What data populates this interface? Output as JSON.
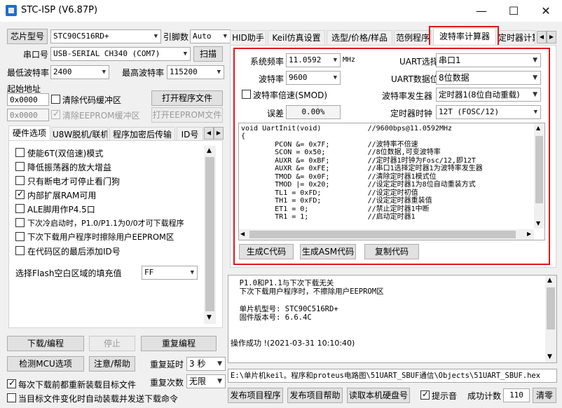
{
  "window": {
    "title": "STC-ISP (V6.87P)",
    "min": "—",
    "max": "☐",
    "close": "✕"
  },
  "left": {
    "chip_label": "芯片型号",
    "chip_value": "STC90C516RD+",
    "pin_label": "引脚数",
    "pin_value": "Auto",
    "port_label": "串口号",
    "port_value": "USB-SERIAL CH340 (COM7)",
    "scan_btn": "扫描",
    "min_baud_label": "最低波特率",
    "min_baud_value": "2400",
    "max_baud_label": "最高波特率",
    "max_baud_value": "115200",
    "start_addr_label": "起始地址",
    "addr1": "0x0000",
    "clear_code": "清除代码缓冲区",
    "open_prog": "打开程序文件",
    "addr2": "0x0000",
    "clear_eeprom": "清除EEPROM缓冲区",
    "open_eeprom": "打开EEPROM文件",
    "tabs": [
      "硬件选项",
      "U8W脱机/联机",
      "程序加密后传输",
      "ID号"
    ],
    "options": [
      {
        "label": "使能6T(双倍速)模式",
        "checked": false
      },
      {
        "label": "降低振荡器的放大增益",
        "checked": false
      },
      {
        "label": "只有断电才可停止看门狗",
        "checked": false
      },
      {
        "label": "内部扩展RAM可用",
        "checked": true
      },
      {
        "label": "ALE脚用作P4.5口",
        "checked": false
      },
      {
        "label": "下次冷启动时，P1.0/P1.1为0/0才可下载程序",
        "checked": false
      },
      {
        "label": "下次下载用户程序时擦除用户EEPROM区",
        "checked": false
      },
      {
        "label": "在代码区的最后添加ID号",
        "checked": false
      }
    ],
    "flash_fill_label": "选择Flash空白区域的填充值",
    "flash_fill_value": "FF",
    "download_btn": "下载/编程",
    "stop_btn": "停止",
    "reprog_btn": "重复编程",
    "detect_btn": "检测MCU选项",
    "help_btn": "注意/帮助",
    "delay_label": "重复延时",
    "delay_value": "3 秒",
    "reload_cb": "每次下载前都重新装载目标文件",
    "count_label": "重复次数",
    "count_value": "无限",
    "autoload_cb": "当目标文件变化时自动装载并发送下载命令"
  },
  "right": {
    "tabs": [
      "HID助手",
      "Keil仿真设置",
      "选型/价格/样品",
      "范例程序",
      "波特率计算器",
      "定时器计算"
    ],
    "sysfreq_label": "系统频率",
    "sysfreq_value": "11.0592",
    "mhz": "MHz",
    "uart_sel_label": "UART选择",
    "uart_sel_value": "串口1",
    "baud_label": "波特率",
    "baud_value": "9600",
    "uart_bits_label": "UART数据位",
    "uart_bits_value": "8位数据",
    "smod_label": "波特率倍速(SMOD)",
    "gen_label": "波特率发生器",
    "gen_value": "定时器1(8位自动重载)",
    "err_label": "误差",
    "err_value": "0.00%",
    "clk_label": "定时器时钟",
    "clk_value": "12T (FOSC/12)",
    "code": [
      "void UartInit(void)           //9600bps@11.0592MHz",
      "{",
      "        PCON &= 0x7F;         //波特率不倍速",
      "        SCON = 0x50;          //8位数据,可变波特率",
      "        AUXR &= 0xBF;         //定时器1时钟为Fosc/12,即12T",
      "        AUXR &= 0xFE;         //串口1选择定时器1为波特率发生器",
      "        TMOD &= 0x0F;         //清除定时器1模式位",
      "        TMOD |= 0x20;         //设定定时器1为8位自动重装方式",
      "        TL1 = 0xFD;           //设定定时初值",
      "        TH1 = 0xFD;           //设定定时器重装值",
      "        ET1 = 0;              //禁止定时器1中断",
      "        TR1 = 1;              //启动定时器1"
    ],
    "gen_c_btn": "生成C代码",
    "gen_asm_btn": "生成ASM代码",
    "copy_btn": "复制代码",
    "log": [
      "  P1.0和P1.1与下次下载无关",
      "  下次下载用户程序时，不擦除用户EEPROM区",
      "",
      "  单片机型号: STC90C516RD+",
      "  固件版本号: 6.6.4C",
      "",
      "",
      "操作成功 !(2021-03-31 10:10:40)"
    ],
    "path": "E:\\单片机keil。程序和proteus电路图\\51UART_SBUF通信\\Objects\\51UART_SBUF.hex",
    "publish_btn": "发布项目程序",
    "publish_help_btn": "发布项目帮助",
    "read_disk_btn": "读取本机硬盘号",
    "beep_cb": "提示音",
    "success_label": "成功计数",
    "success_value": "110",
    "clear_btn": "清零"
  }
}
